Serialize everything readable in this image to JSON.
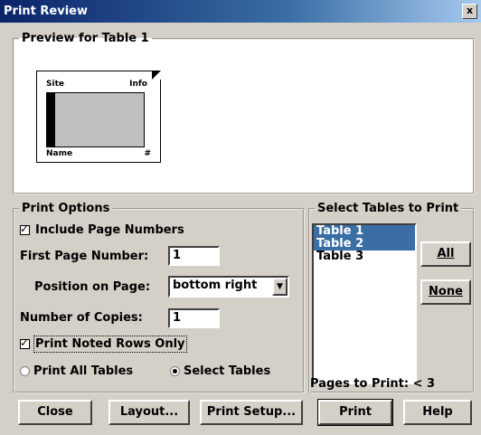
{
  "window": {
    "title": "Print Review",
    "close_glyph": "x"
  },
  "preview": {
    "legend": "Preview for Table 1",
    "thumb": {
      "site": "Site",
      "info": "Info",
      "name": "Name",
      "number": "#"
    }
  },
  "print_options": {
    "legend": "Print Options",
    "include_page_numbers": {
      "label": "Include Page Numbers",
      "checked": true
    },
    "first_page_number": {
      "label": "First Page Number:",
      "value": "1"
    },
    "position_on_page": {
      "label": "Position on Page:",
      "value": "bottom right"
    },
    "number_of_copies": {
      "label": "Number of Copies:",
      "value": "1"
    },
    "print_noted_rows_only": {
      "label": "Print Noted Rows Only",
      "checked": true
    },
    "radio_print_all": {
      "label": "Print All Tables",
      "selected": false
    },
    "radio_select_tables": {
      "label": "Select Tables",
      "selected": true
    }
  },
  "select_tables": {
    "legend": "Select Tables to Print",
    "items": [
      {
        "label": "Table 1",
        "selected": true
      },
      {
        "label": "Table 2",
        "selected": true
      },
      {
        "label": "Table 3",
        "selected": false
      }
    ],
    "all_label": "All",
    "none_label": "None"
  },
  "pages_to_print": "Pages to Print: < 3",
  "buttons": {
    "close": "Close",
    "layout": "Layout...",
    "print_setup": "Print Setup...",
    "print": "Print",
    "help": "Help"
  },
  "colors": {
    "face": "#d4d0c8",
    "selection": "#3a6ea5",
    "title_start": "#0a246a"
  }
}
